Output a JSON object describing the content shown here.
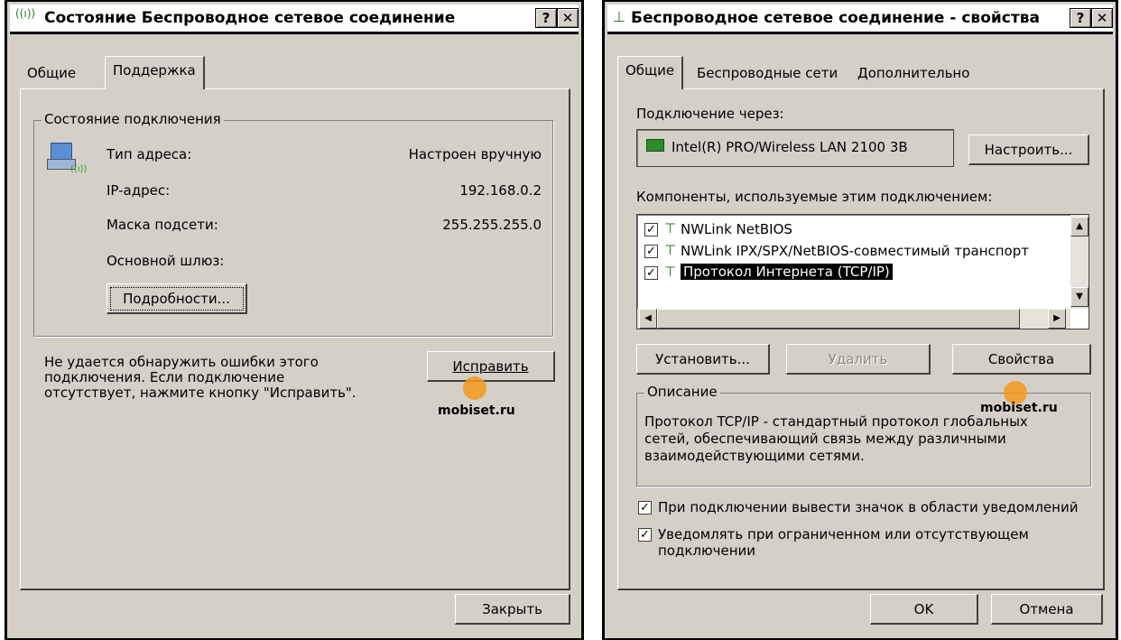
{
  "status_dialog": {
    "title": "Состояние Беспроводное сетевое соединение",
    "help_button": "?",
    "close_button": "✕",
    "tabs": [
      "Общие",
      "Поддержка"
    ],
    "group_label": "Состояние подключения",
    "rows": [
      {
        "label": "Тип адреса:",
        "value": "Настроен вручную"
      },
      {
        "label": "IP-адрес:",
        "value": "192.168.0.2"
      },
      {
        "label": "Маска подсети:",
        "value": "255.255.255.0"
      },
      {
        "label": "Основной шлюз:",
        "value": ""
      }
    ],
    "details_button": "Подробности...",
    "repair_text": [
      "Не удается обнаружить ошибки этого",
      "подключения. Если подключение",
      "отсутствует, нажмите кнопку \"Исправить\"."
    ],
    "repair_button": "Исправить",
    "close_dialog_button": "Закрыть",
    "watermark": "mobiset.ru"
  },
  "props_dialog": {
    "title": "Беспроводное сетевое соединение - свойства",
    "help_button": "?",
    "close_button": "✕",
    "tabs": [
      "Общие",
      "Беспроводные сети",
      "Дополнительно"
    ],
    "connect_using_label": "Подключение через:",
    "adapter_name": "Intel(R) PRO/Wireless LAN 2100 3B",
    "configure_button": "Настроить...",
    "components_label": "Компоненты, используемые этим подключением:",
    "components": [
      {
        "name": "NWLink NetBIOS",
        "checked": true
      },
      {
        "name": "NWLink IPX/SPX/NetBIOS-совместимый транспорт",
        "checked": true
      },
      {
        "name": "Протокол Интернета (TCP/IP)",
        "checked": true,
        "selected": true
      }
    ],
    "install_button": "Установить...",
    "uninstall_button": "Удалить",
    "properties_button": "Свойства",
    "description_label": "Описание",
    "description_lines": [
      "Протокол TCP/IP - стандартный протокол глобальных",
      "сетей, обеспечивающий связь между различными",
      "взаимодействующими сетями."
    ],
    "option_show_icon": "При подключении вывести значок в области уведомлений",
    "option_notify_lines": [
      "Уведомлять при ограниченном или отсутствующем",
      "подключении"
    ],
    "ok_button": "OK",
    "cancel_button": "Отмена",
    "watermark": "mobiset.ru"
  },
  "colors": {
    "dialog_bg": "#d4d0c8",
    "selection": "#000000",
    "watermark_orange": "#f39a1c"
  }
}
